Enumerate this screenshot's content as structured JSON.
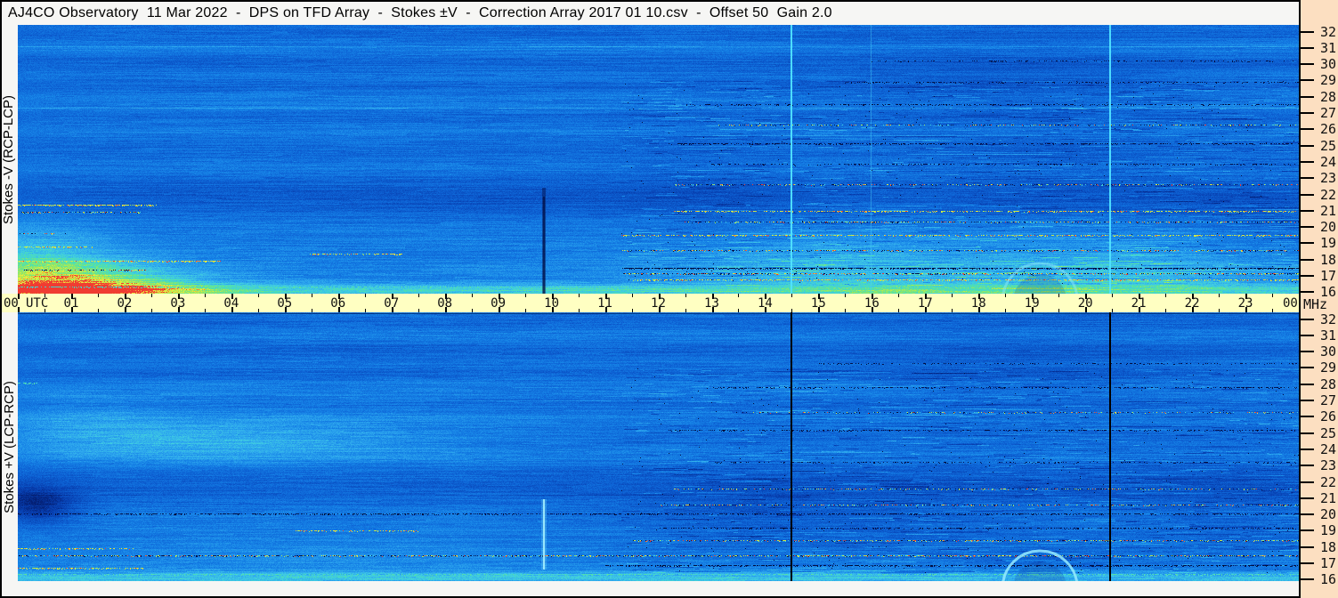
{
  "header": {
    "title": "AJ4CO Observatory  11 Mar 2022  -  DPS on TFD Array  -  Stokes ±V  -  Correction Array 2017 01 10.csv  -  Offset 50  Gain 2.0"
  },
  "panels": [
    {
      "label": "Stokes -V (RCP-LCP)"
    },
    {
      "label": "Stokes +V (LCP-RCP)"
    }
  ],
  "time_axis": {
    "utc_label": "UTC",
    "unit_right": "MHz"
  },
  "colors": {
    "axis_bg": "#ffffc2",
    "margin_bg": "#fcdfc1",
    "title_bg": "#f6f6f4",
    "border": "#000000",
    "spectrum_base_blue": "#167ee2",
    "marker_cyan": "#50e1ff"
  },
  "chart_data": {
    "type": "heatmap",
    "title": "AJ4CO Observatory 11 Mar 2022 - DPS on TFD Array - Stokes ±V",
    "xlabel": "UTC",
    "ylabel": "MHz",
    "x_range_hours": [
      0,
      24
    ],
    "y_range_mhz": [
      16,
      32
    ],
    "x_tick_labels": [
      "00",
      "01",
      "02",
      "03",
      "04",
      "05",
      "06",
      "07",
      "08",
      "09",
      "10",
      "11",
      "12",
      "13",
      "14",
      "15",
      "16",
      "17",
      "18",
      "19",
      "20",
      "21",
      "22",
      "23",
      "00"
    ],
    "y_tick_labels": [
      "32",
      "31",
      "30",
      "29",
      "28",
      "27",
      "26",
      "25",
      "24",
      "23",
      "22",
      "21",
      "20",
      "19",
      "18",
      "17",
      "16"
    ],
    "grid": false,
    "legend": "none",
    "panels": [
      {
        "name": "Stokes -V (RCP-LCP)",
        "vertical_lines": [
          {
            "utc": 14.48,
            "style": "bright"
          },
          {
            "utc": 15.98,
            "style": "faint-bright"
          },
          {
            "utc": 20.45,
            "style": "bright"
          }
        ],
        "notable_features": [
          "bright cyan-green enhancement 16-19 MHz near 00-02 UTC with yellow RFI streaks",
          "smooth banded blue background 00-11 UTC",
          "dense speckled RFI (dark/yellow dashes) 17-28 MHz from about 12-24 UTC",
          "narrow dark vertical streak near 09:50 UTC below 22 MHz",
          "diffuse darker region 27-31 MHz near 16-20 UTC",
          "arc-shaped feature near 19:10 UTC at 16-17.5 MHz",
          "bright speckled edge line near 16.3 MHz across full day"
        ]
      },
      {
        "name": "Stokes +V (LCP-RCP)",
        "vertical_lines": [
          {
            "utc": 14.48,
            "style": "black"
          },
          {
            "utc": 20.45,
            "style": "black"
          }
        ],
        "notable_features": [
          "bright cyan band 24-25 MHz from 00-09 UTC",
          "bright vertical streak near 09:50 UTC 16.5-21 MHz",
          "dark patch near 00:20 UTC 20-21.5 MHz at left edge",
          "dashed dark RFI line near 20 MHz across full day",
          "dense speckled RFI 16-28 MHz from about 12-24 UTC",
          "arc-shaped bright feature near 19:10 UTC at 16-17.5 MHz"
        ]
      }
    ]
  }
}
